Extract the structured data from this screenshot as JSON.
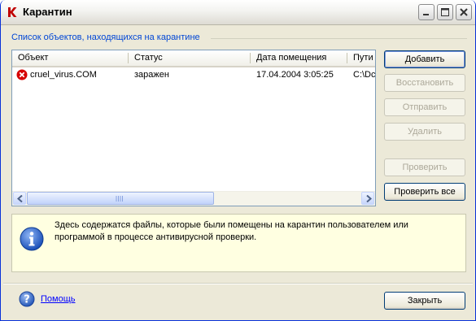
{
  "window": {
    "title": "Карантин"
  },
  "group": {
    "title": "Список объектов, находящихся на карантине"
  },
  "list": {
    "columns": [
      "Объект",
      "Статус",
      "Дата помещения",
      "Путь"
    ],
    "columns_visible": [
      "Объект",
      "Статус",
      "Дата помещения",
      "Пути"
    ],
    "rows": [
      {
        "object": "cruel_virus.COM",
        "status": "заражен",
        "date": "17.04.2004 3:05:25",
        "path": "C:\\Dc",
        "icon": "error-x-icon"
      }
    ]
  },
  "buttons": {
    "add": "Добавить",
    "restore": "Восстановить",
    "send": "Отправить",
    "delete": "Удалить",
    "check": "Проверить",
    "check_all": "Проверить все",
    "close": "Закрыть"
  },
  "info": {
    "text": "Здесь содержатся файлы, которые были помещены на карантин пользователем или программой в процессе антивирусной проверки.",
    "icon": "info-icon"
  },
  "footer": {
    "help_label": "Помощь",
    "help_icon": "help-icon"
  },
  "colors": {
    "accent": "#0046d5",
    "info_bg": "#ffffe1",
    "error_red": "#d60000"
  }
}
